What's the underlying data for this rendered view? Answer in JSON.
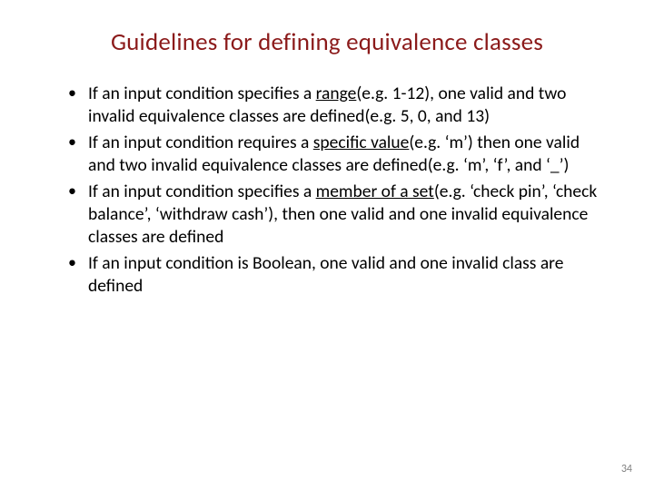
{
  "title": "Guidelines for defining equivalence classes",
  "bullets": [
    {
      "pre": "If an input condition specifies a ",
      "u": "range",
      "post": "(e.g. 1-12), one valid and two invalid equivalence classes are defined(e.g. 5, 0, and 13)"
    },
    {
      "pre": "If an input condition requires a ",
      "u": "specific value",
      "post": "(e.g. ‘m’) then one valid and two invalid equivalence classes are defined(e.g. ‘m’, ‘f’, and ‘_’)"
    },
    {
      "pre": "If an input condition specifies a ",
      "u": "member of a set",
      "post": "(e.g. ‘check pin’, ‘check balance’, ‘withdraw cash’), then one valid and one invalid equivalence classes are defined"
    },
    {
      "pre": "If an input condition is Boolean, one valid and one invalid class are defined",
      "u": "",
      "post": ""
    }
  ],
  "page_number": "34"
}
